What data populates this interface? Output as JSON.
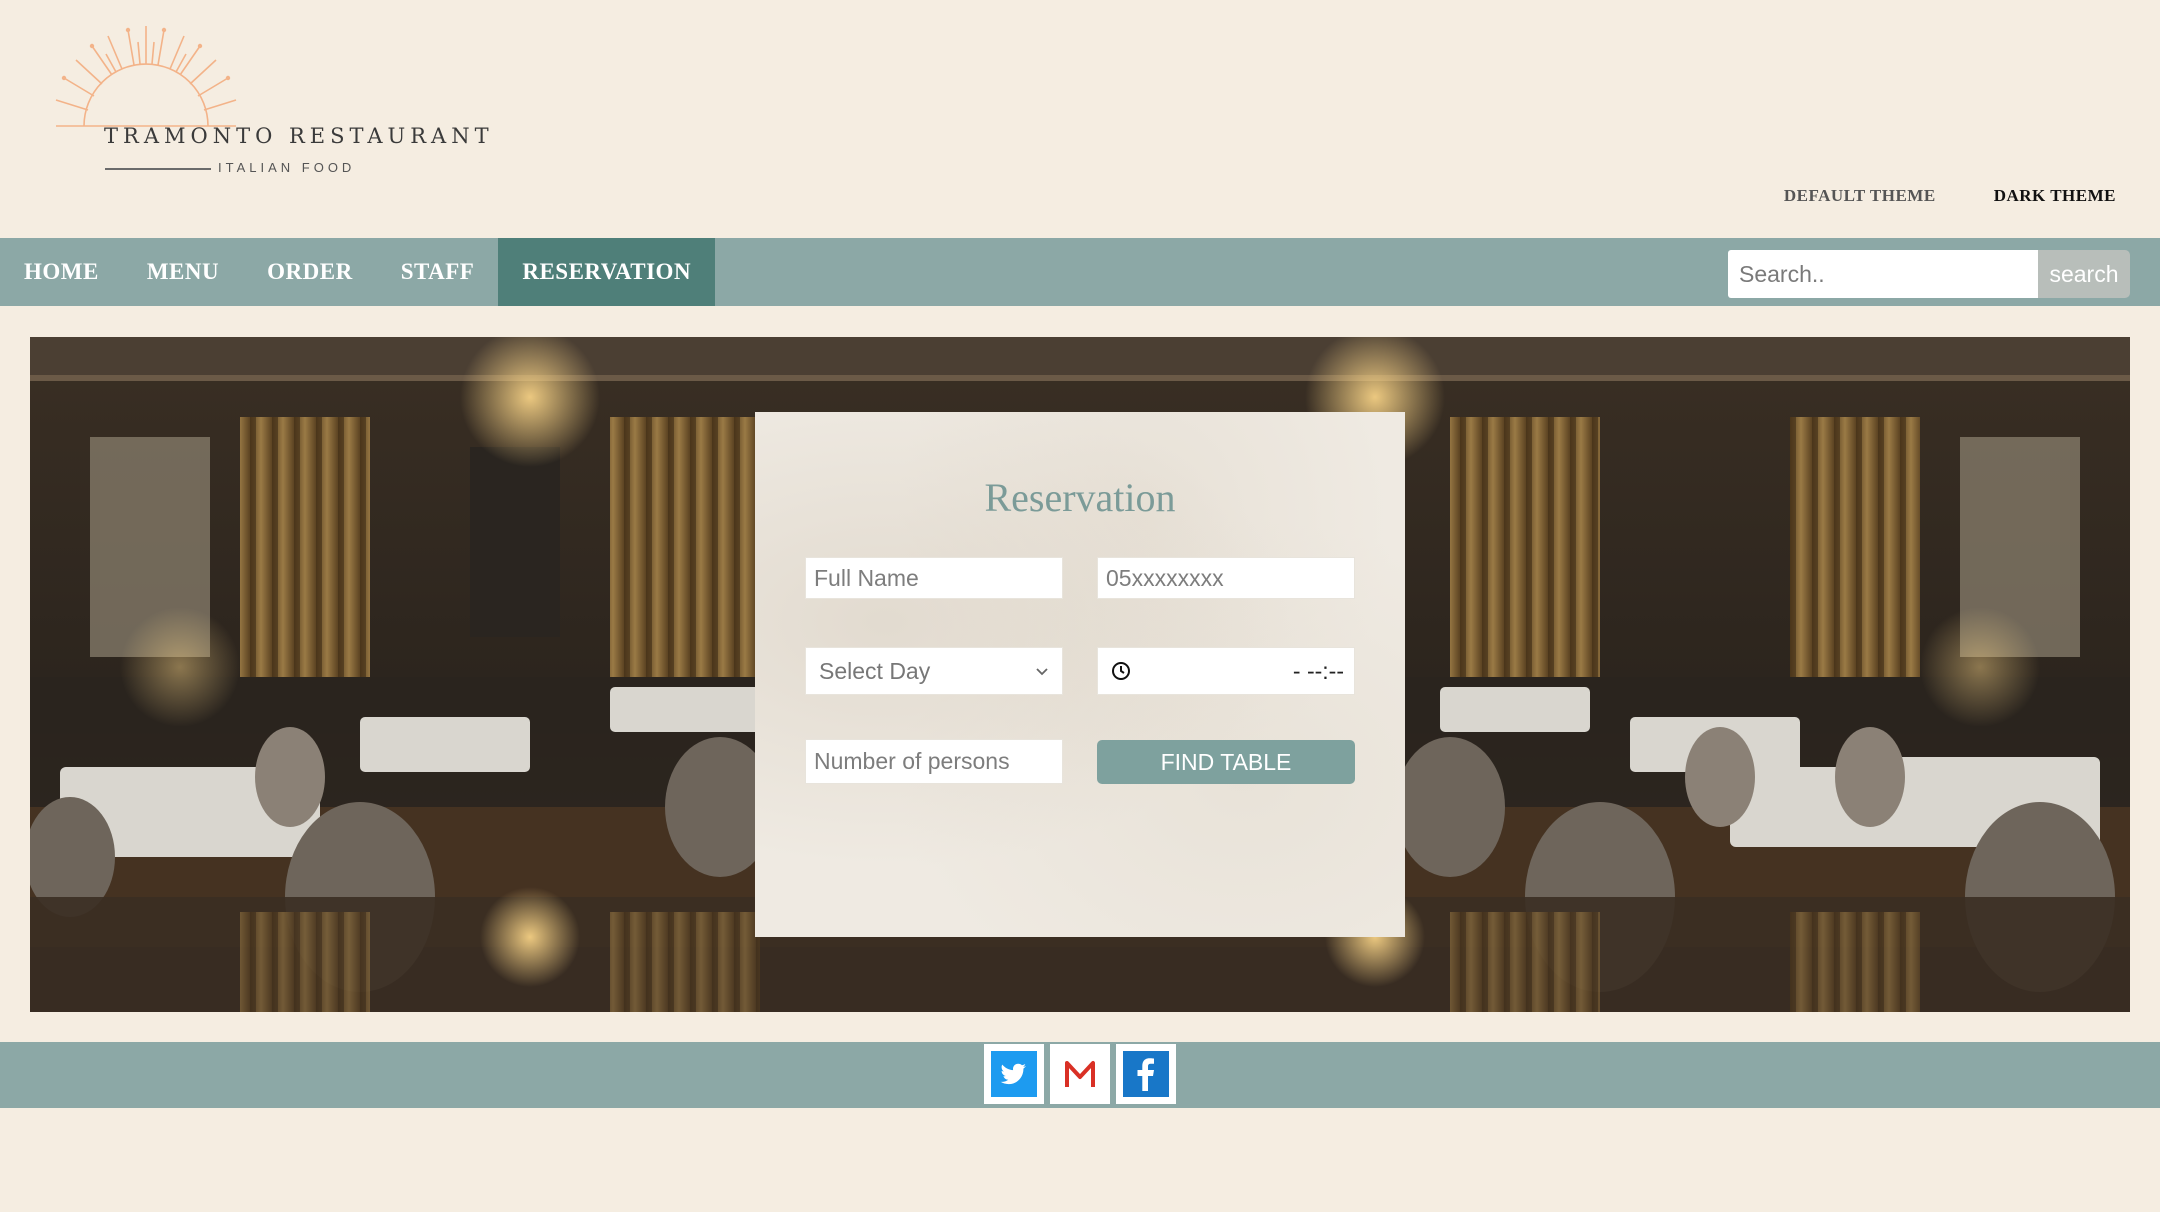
{
  "brand": {
    "name": "TRAMONTO RESTAURANT",
    "tagline": "ITALIAN FOOD",
    "accent_color": "#f3b389"
  },
  "themes": {
    "default_label": "DEFAULT THEME",
    "dark_label": "DARK THEME"
  },
  "nav": {
    "items": [
      {
        "label": "HOME"
      },
      {
        "label": "MENU"
      },
      {
        "label": "ORDER"
      },
      {
        "label": "STAFF"
      },
      {
        "label": "RESERVATION",
        "active": true
      }
    ],
    "search_placeholder": "Search..",
    "search_button": "search",
    "bar_color": "#8ca8a6",
    "active_color": "#4f7f79"
  },
  "reservation": {
    "title": "Reservation",
    "full_name_placeholder": "Full Name",
    "phone_placeholder": "05xxxxxxxx",
    "day_select_value": "Select Day",
    "time_value": "- --:--",
    "persons_placeholder": "Number of persons",
    "submit_label": "FIND TABLE",
    "accent_color": "#7ea19e"
  },
  "footer": {
    "social": [
      {
        "icon": "twitter-icon"
      },
      {
        "icon": "gmail-icon"
      },
      {
        "icon": "facebook-icon"
      }
    ]
  }
}
